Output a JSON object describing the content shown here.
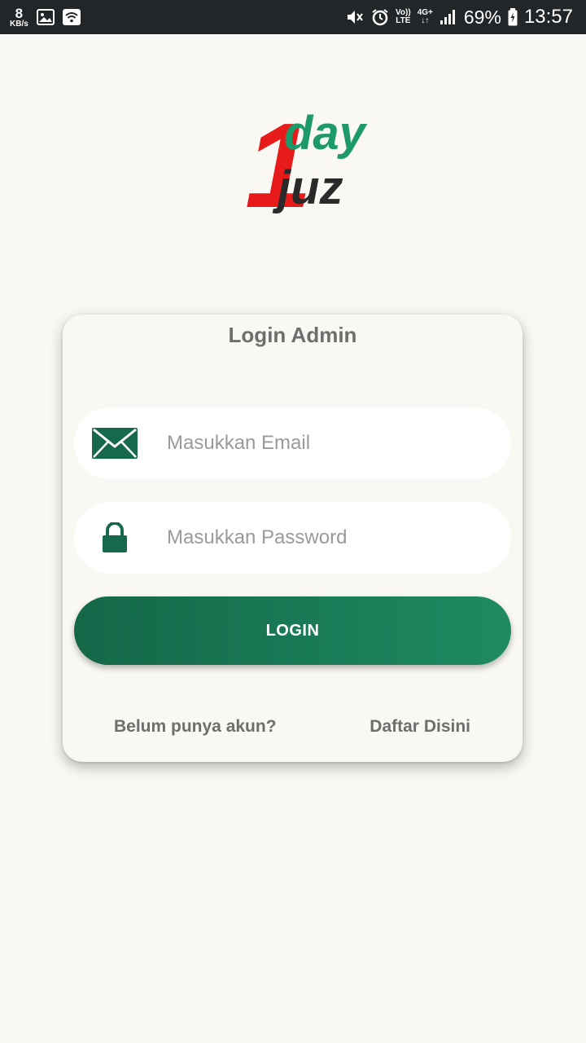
{
  "status_bar": {
    "net_speed_value": "8",
    "net_speed_unit": "KB/s",
    "volte_top": "Vo))",
    "volte_bottom": "LTE",
    "network_type": "4G+",
    "battery_percent": "69%",
    "time": "13:57"
  },
  "logo": {
    "numeral": "1",
    "word_top": "day",
    "word_bottom": "juz",
    "colors": {
      "green": "#1e9a6a",
      "red": "#e81b1b",
      "dark": "#2a2a2a"
    }
  },
  "login": {
    "title": "Login Admin",
    "email_placeholder": "Masukkan Email",
    "email_value": "",
    "password_placeholder": "Masukkan Password",
    "password_value": "",
    "button_label": "LOGIN",
    "no_account_text": "Belum punya akun?",
    "register_link": "Daftar Disini"
  },
  "icons": {
    "email": "envelope-icon",
    "password": "lock-icon"
  },
  "colors": {
    "background": "#f9f8f2",
    "accent_green": "#1a7a57",
    "text_gray": "#6e6e6e",
    "status_bar": "#232628"
  }
}
